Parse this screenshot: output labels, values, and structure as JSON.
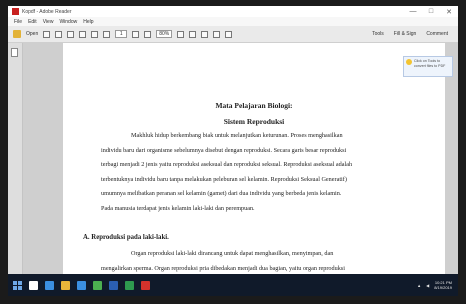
{
  "window": {
    "title": "Kopdf - Adobe Reader",
    "controls": [
      "—",
      "□",
      "✕"
    ]
  },
  "menu": [
    "File",
    "Edit",
    "View",
    "Window",
    "Help"
  ],
  "toolbar": {
    "open_label": "Open",
    "page_number": "1",
    "zoom": "80%",
    "right_items": [
      "Tools",
      "Fill & Sign",
      "Comment"
    ]
  },
  "tooltip": {
    "text": "Click on Tools to convert files to PDF"
  },
  "document": {
    "title_line1": "Mata Pelajaran Biologi:",
    "title_line2": "Sistem Reproduksi",
    "paragraph1_lines": [
      "Makhluk hidup berkembang biak untuk melanjutkan keturunan. Proses menghasilkan",
      "individu baru dari organisme sebelumnya disebut dengan reproduksi. Secara garis besar reproduksi",
      "terbagi menjadi 2 jenis yaitu reproduksi aseksual dan reproduksi seksual. Reproduksi aseksual adalah",
      "terbentuknya individu baru tanpa melakukan peleburan sel kelamin. Reproduksi Seksual  Generatif)",
      "umumnya melibatkan peranan sel kelamin (gamet) dari dua individu yang berbeda jenis kelamin.",
      "Pada manusia terdapat jenis kelamin laki-laki dan perempuan."
    ],
    "heading_a": "A.  Reproduksi pada laki-laki.",
    "paragraph2_lines": [
      "Organ reproduksi laki-laki dirancang untuk dapat menghasilkan, menyimpan, dan",
      "mengalirkan sperma. Organ reproduksi pria dibedakan menjadi dua bagian, yaitu organ reproduksi"
    ]
  },
  "taskbar": {
    "icons": [
      "task-view-icon",
      "edge-icon",
      "explorer-icon",
      "store-icon",
      "chrome-icon",
      "word-icon",
      "excel-icon",
      "acrobat-icon"
    ],
    "colors": [
      "#ffffff",
      "#3b8fe0",
      "#e8b53a",
      "#3b8fe0",
      "#4caf50",
      "#2b5fb3",
      "#2e9a4f",
      "#d4322c"
    ],
    "clock_time": "10:21 PM",
    "clock_date": "8/19/2019"
  }
}
